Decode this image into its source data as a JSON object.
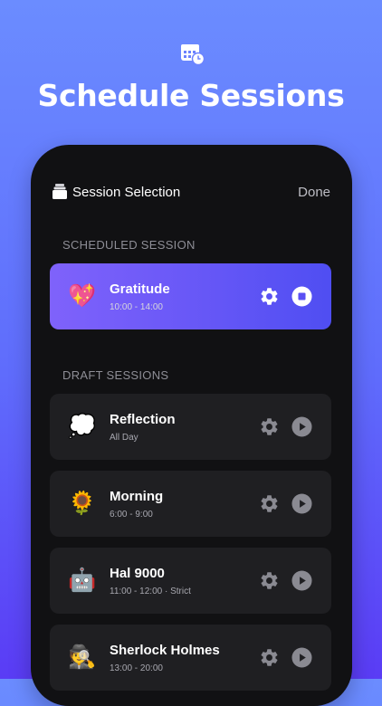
{
  "header": {
    "title": "Schedule Sessions",
    "icon": "calendar-clock-icon"
  },
  "topbar": {
    "title": "Session Selection",
    "done_label": "Done"
  },
  "scheduled": {
    "section_label": "SCHEDULED SESSION",
    "sessions": [
      {
        "emoji": "💖",
        "name": "Gratitude",
        "time": "10:00 - 14:00"
      }
    ]
  },
  "drafts": {
    "section_label": "DRAFT SESSIONS",
    "sessions": [
      {
        "emoji": "💭",
        "name": "Reflection",
        "time": "All Day"
      },
      {
        "emoji": "🌻",
        "name": "Morning",
        "time": "6:00 - 9:00"
      },
      {
        "emoji": "🤖",
        "name": "Hal 9000",
        "time": "11:00 - 12:00 · Strict"
      },
      {
        "emoji": "🕵️",
        "name": "Sherlock Holmes",
        "time": "13:00 - 20:00"
      }
    ]
  },
  "colors": {
    "accent_start": "#7f62fb",
    "accent_end": "#4f4ef2",
    "phone_bg": "#111113",
    "card_bg": "#1f1f22"
  }
}
